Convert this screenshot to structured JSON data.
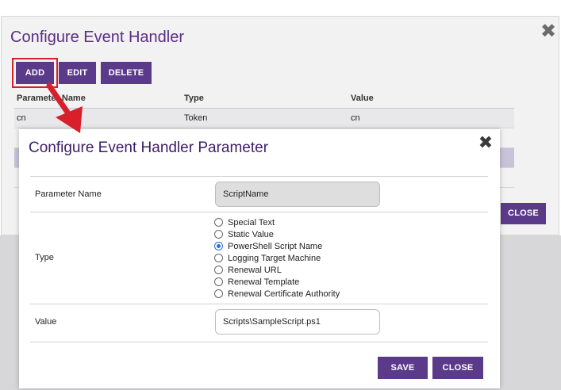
{
  "outer_dialog": {
    "title": "Configure Event Handler",
    "close_glyph": "✖",
    "toolbar": {
      "add_label": "ADD",
      "edit_label": "EDIT",
      "delete_label": "DELETE"
    },
    "close_label": "CLOSE",
    "grid": {
      "columns": [
        "Parameter Name",
        "Type",
        "Value"
      ],
      "rows": [
        [
          "cn",
          "Token",
          "cn"
        ],
        [
          "",
          "",
          ""
        ],
        [
          "",
          "",
          ""
        ],
        [
          "",
          "",
          ""
        ]
      ]
    }
  },
  "inner_dialog": {
    "title": "Configure Event Handler Parameter",
    "close_glyph": "✖",
    "parameter_name": {
      "label": "Parameter Name",
      "value": "ScriptName"
    },
    "type": {
      "label": "Type",
      "options": [
        "Special Text",
        "Static Value",
        "PowerShell Script Name",
        "Logging Target Machine",
        "Renewal URL",
        "Renewal Template",
        "Renewal Certificate Authority"
      ],
      "selected": "PowerShell Script Name"
    },
    "value": {
      "label": "Value",
      "value": "Scripts\\SampleScript.ps1"
    },
    "save_label": "SAVE",
    "close_label": "CLOSE"
  },
  "colors": {
    "brand_purple": "#5b3a8a",
    "title_purple": "#5b2d83",
    "highlight_red": "#d8202c",
    "radio_selected": "#2b6fd6"
  },
  "icons": [
    "close-icon",
    "arrow-annotation"
  ]
}
